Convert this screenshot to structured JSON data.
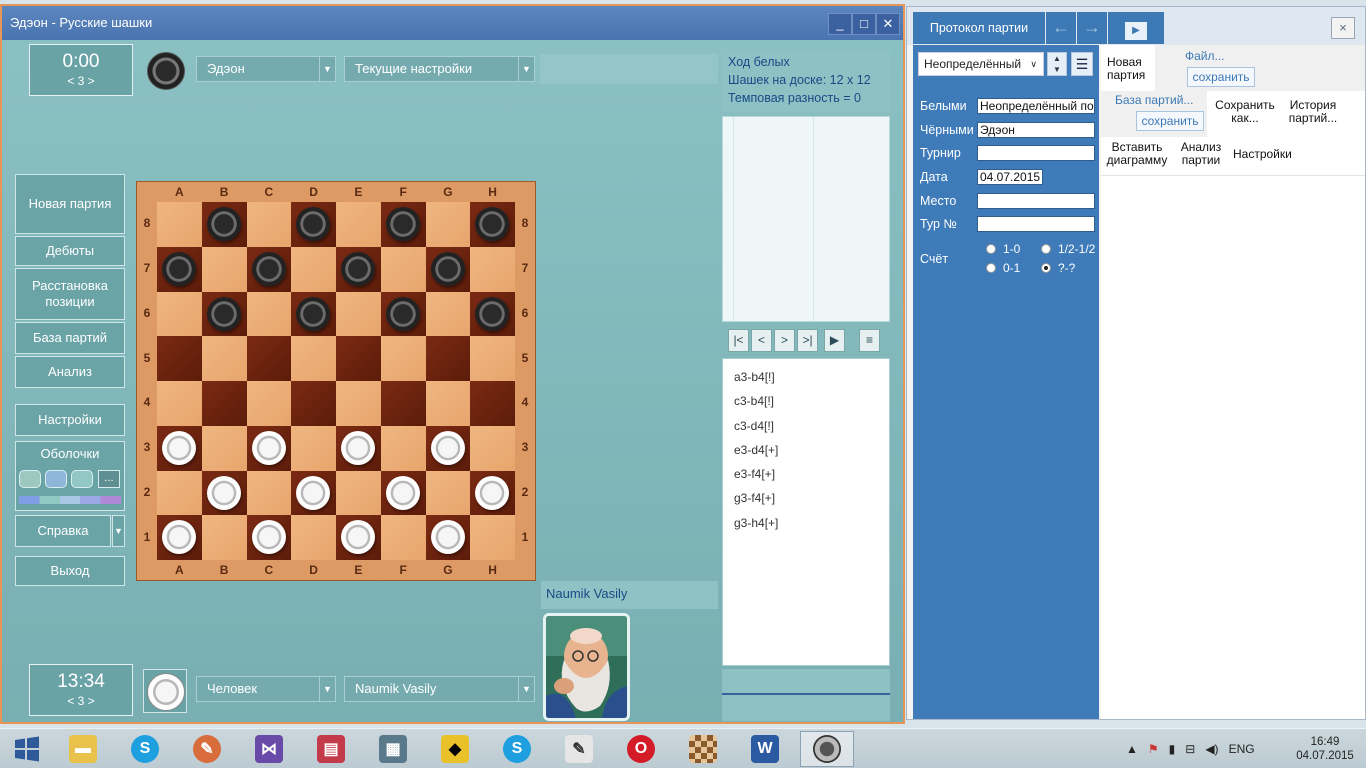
{
  "main_window": {
    "title": "Эдэон - Русские шашки",
    "min_btn": "_",
    "max_btn": "□",
    "close_btn": "✕"
  },
  "top_player": {
    "clock": "0:00",
    "move_indicator": "< 3 >",
    "engine": "Эдэон",
    "settings": "Текущие настройки"
  },
  "bottom_player": {
    "clock": "13:34",
    "move_indicator": "< 3 >",
    "type": "Человек",
    "name": "Naumik Vasily"
  },
  "sidebar": {
    "new_game": "Новая партия",
    "openings": "Дебюты",
    "setup_line1": "Расстановка",
    "setup_line2": "позиции",
    "database": "База партий",
    "analysis": "Анализ",
    "settings": "Настройки",
    "skins": "Оболочки",
    "skins_more": "...",
    "help": "Справка",
    "exit": "Выход"
  },
  "board": {
    "files": [
      "A",
      "B",
      "C",
      "D",
      "E",
      "F",
      "G",
      "H"
    ],
    "ranks": [
      "8",
      "7",
      "6",
      "5",
      "4",
      "3",
      "2",
      "1"
    ],
    "pieces": {
      "black": [
        "b8",
        "d8",
        "f8",
        "h8",
        "a7",
        "c7",
        "e7",
        "g7",
        "b6",
        "d6",
        "f6",
        "h6"
      ],
      "white": [
        "a3",
        "c3",
        "e3",
        "g3",
        "b2",
        "d2",
        "f2",
        "h2",
        "a1",
        "c1",
        "e1",
        "g1"
      ]
    }
  },
  "info": {
    "turn": "Ход белых",
    "count": "Шашек на доске: 12 x 12",
    "tempo": "Темповая разность = 0"
  },
  "nav_buttons": [
    "|<",
    "<",
    ">",
    ">|",
    "▶",
    "≡"
  ],
  "moves": [
    "a3-b4[!]",
    "c3-b4[!]",
    "c3-d4[!]",
    "e3-d4[+]",
    "e3-f4[+]",
    "g3-f4[+]",
    "g3-h4[+]"
  ],
  "opponent_name": "Naumik Vasily",
  "protocol": {
    "tab": "Протокол партии",
    "close": "×",
    "result_combo": "Неопределённый",
    "fields": {
      "white_label": "Белыми",
      "white_value": "Неопределённый по",
      "black_label": "Чёрными",
      "black_value": "Эдэон",
      "tournament_label": "Турнир",
      "tournament_value": "",
      "date_label": "Дата",
      "date_value": "04.07.2015",
      "place_label": "Место",
      "place_value": "",
      "round_label": "Тур №",
      "round_value": ""
    },
    "score_label": "Счёт",
    "score_options": [
      "1-0",
      "1/2-1/2",
      "0-1",
      "?-?"
    ],
    "menu": {
      "new_game_line1": "Новая",
      "new_game_line2": "партия",
      "file": "Файл...",
      "save": "сохранить",
      "database": "База партий...",
      "db_save": "сохранить",
      "save_as_line1": "Сохранить",
      "save_as_line2": "как...",
      "history_line1": "История",
      "history_line2": "партий...",
      "insert_line1": "Вставить",
      "insert_line2": "диаграмму",
      "analysis_line1": "Анализ",
      "analysis_line2": "партии",
      "settings": "Настройки"
    }
  },
  "taskbar": {
    "lang": "ENG",
    "time": "16:49",
    "date": "04.07.2015"
  },
  "colors": {
    "window_bg": "#8cc1c4",
    "title_bar": "#4a74b0",
    "protocol_blue": "#3e7bb8",
    "board_light": "#f0b680",
    "board_dark": "#6b230f"
  }
}
